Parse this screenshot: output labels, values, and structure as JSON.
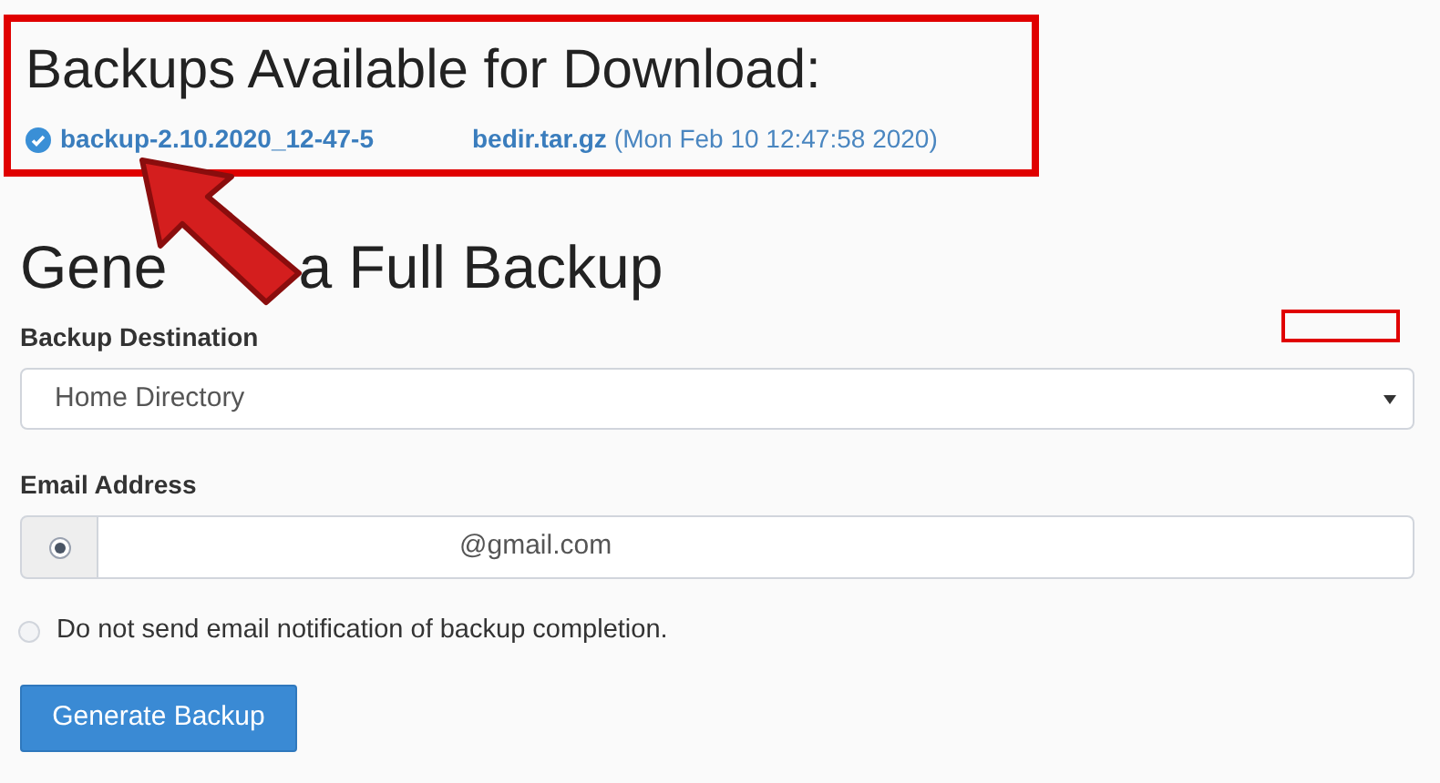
{
  "backups": {
    "title": "Backups Available for Download:",
    "items": [
      {
        "name": "backup-2.10.2020_12-47-5",
        "name_end": "bedir.tar.gz",
        "date": "(Mon Feb 10 12:47:58 2020)"
      }
    ]
  },
  "generate": {
    "title_start": "Gene",
    "title_end": "a Full Backup",
    "destination": {
      "label": "Backup Destination",
      "value": "Home Directory"
    },
    "email": {
      "label": "Email Address",
      "selected": true,
      "value": "@gmail.com"
    },
    "no_notify": {
      "label": "Do not send email notification of backup completion.",
      "selected": false
    },
    "button": "Generate Backup"
  }
}
